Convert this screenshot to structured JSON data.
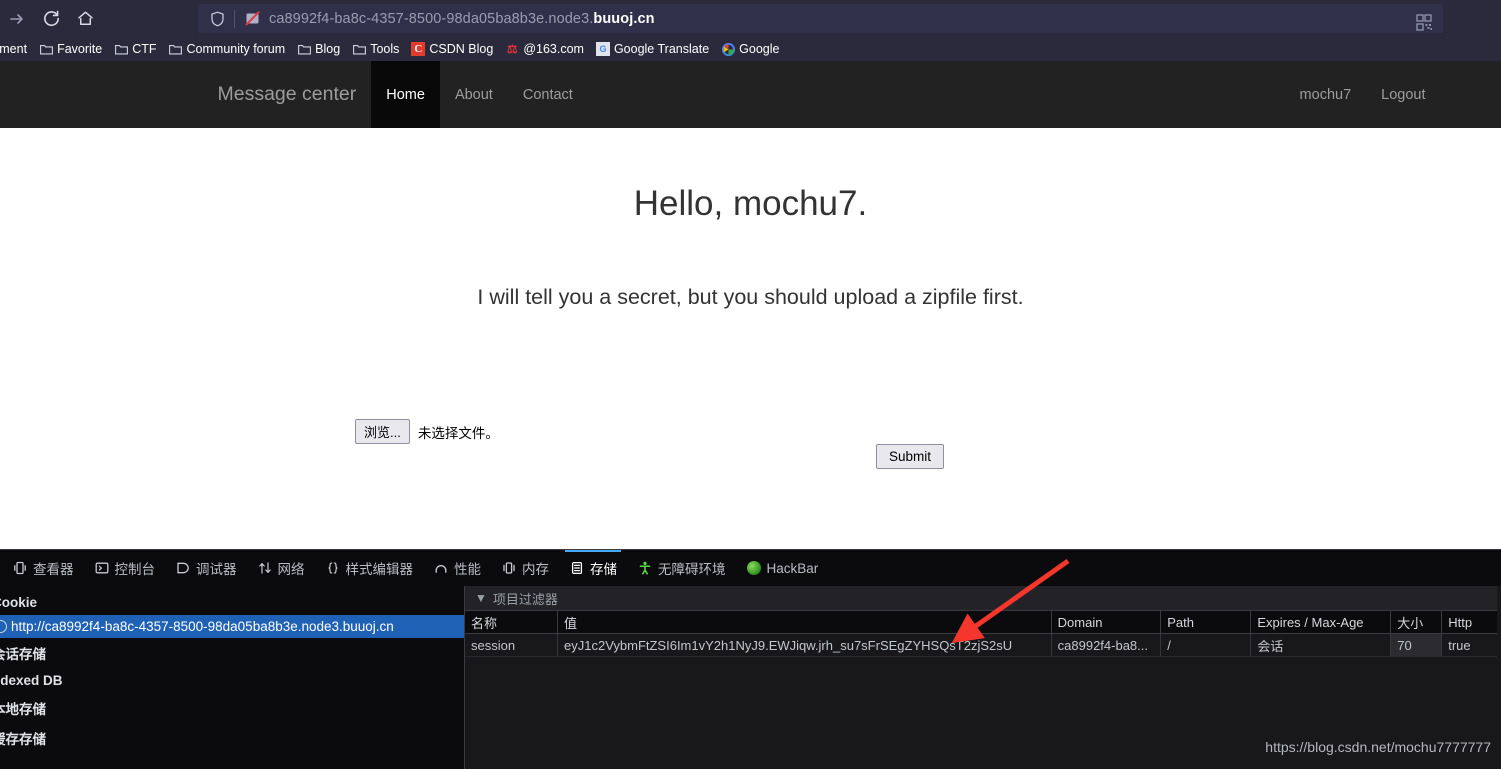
{
  "browser": {
    "nav": {
      "forward_label": "→",
      "reload_label": "reload",
      "home_label": "home"
    },
    "url": {
      "prefix": "ca8992f4-ba8c-4357-8500-98da05ba8b3e.node3.",
      "domain": "buuoj.cn",
      "full": "ca8992f4-ba8c-4357-8500-98da05ba8b3e.node3.buuoj.cn"
    },
    "bookmarks": [
      {
        "label": "ertainment",
        "icon": "folder-icon"
      },
      {
        "label": "Favorite",
        "icon": "folder-icon"
      },
      {
        "label": "CTF",
        "icon": "folder-icon"
      },
      {
        "label": "Community forum",
        "icon": "folder-icon"
      },
      {
        "label": "Blog",
        "icon": "folder-icon"
      },
      {
        "label": "Tools",
        "icon": "folder-icon"
      },
      {
        "label": "CSDN Blog",
        "icon": "csdn-icon"
      },
      {
        "label": "@163.com",
        "icon": "netease-icon"
      },
      {
        "label": "Google Translate",
        "icon": "google-translate-icon"
      },
      {
        "label": "Google",
        "icon": "google-icon"
      }
    ]
  },
  "site": {
    "brand": "Message center",
    "nav_items": [
      {
        "label": "Home",
        "active": true
      },
      {
        "label": "About",
        "active": false
      },
      {
        "label": "Contact",
        "active": false
      }
    ],
    "user_links": [
      {
        "label": "mochu7"
      },
      {
        "label": "Logout"
      }
    ],
    "heading": "Hello, mochu7.",
    "subheading": "I will tell you a secret, but you should upload a zipfile first.",
    "file_button": "浏览...",
    "file_status": "未选择文件。",
    "submit_button": "Submit"
  },
  "devtools": {
    "tabs": [
      {
        "label": "查看器",
        "icon": "inspector-icon",
        "active": false
      },
      {
        "label": "控制台",
        "icon": "console-icon",
        "active": false
      },
      {
        "label": "调试器",
        "icon": "debugger-icon",
        "active": false
      },
      {
        "label": "网络",
        "icon": "network-icon",
        "active": false
      },
      {
        "label": "样式编辑器",
        "icon": "style-editor-icon",
        "active": false
      },
      {
        "label": "性能",
        "icon": "performance-icon",
        "active": false
      },
      {
        "label": "内存",
        "icon": "memory-icon",
        "active": false
      },
      {
        "label": "存储",
        "icon": "storage-icon",
        "active": true
      },
      {
        "label": "无障碍环境",
        "icon": "accessibility-icon",
        "active": false
      },
      {
        "label": "HackBar",
        "icon": "hackbar-icon",
        "active": false
      }
    ],
    "storage_tree": [
      {
        "label": "Cookie",
        "type": "group",
        "selected": false
      },
      {
        "label": "http://ca8992f4-ba8c-4357-8500-98da05ba8b3e.node3.buuoj.cn",
        "type": "item",
        "selected": true
      },
      {
        "label": "会话存储",
        "type": "group",
        "selected": false
      },
      {
        "label": "ndexed DB",
        "type": "group",
        "selected": false
      },
      {
        "label": "本地存储",
        "type": "group",
        "selected": false
      },
      {
        "label": "缓存存储",
        "type": "group",
        "selected": false
      }
    ],
    "filter_placeholder": "项目过滤器",
    "table": {
      "columns": [
        "名称",
        "值",
        "Domain",
        "Path",
        "Expires / Max-Age",
        "大小",
        "Http"
      ],
      "rows": [
        {
          "name": "session",
          "value": "eyJ1c2VybmFtZSI6Im1vY2h1NyJ9.EWJiqw.jrh_su7sFrSEgZYHSQsT2zjS2sU",
          "domain": "ca8992f4-ba8...",
          "path": "/",
          "expires": "会话",
          "size": "70",
          "http": "true"
        }
      ]
    },
    "watermark": "https://blog.csdn.net/mochu7777777"
  },
  "colors": {
    "chrome_bg": "#2b2a3d",
    "urlbar_bg": "#31304a",
    "navbar_bg": "#222222",
    "navbar_active": "#090909",
    "devtools_bg": "#0b0b0d",
    "devtools_panel": "#18181b",
    "accent_blue": "#46a9f7",
    "selection_blue": "#1f62b5",
    "arrow_red": "#f5362c"
  }
}
